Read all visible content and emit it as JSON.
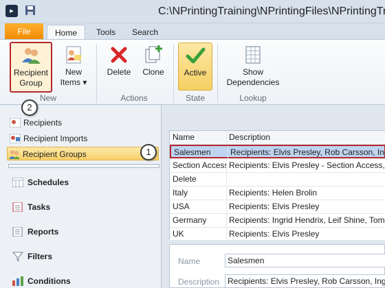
{
  "window": {
    "title": "C:\\NPrintingTraining\\NPrintingFiles\\NPrintingTrain"
  },
  "tabs": {
    "file": "File",
    "home": "Home",
    "tools": "Tools",
    "search": "Search"
  },
  "ribbon": {
    "recipient_group": [
      "Recipient",
      "Group"
    ],
    "new_items": [
      "New",
      "Items ▾"
    ],
    "delete": "Delete",
    "clone": "Clone",
    "active": "Active",
    "show_dependencies": [
      "Show",
      "Dependencies"
    ],
    "groups": {
      "new": "New",
      "actions": "Actions",
      "state": "State",
      "lookup": "Lookup"
    }
  },
  "nav": {
    "items": [
      "Recipients",
      "Recipient Imports",
      "Recipient Groups"
    ],
    "sections": [
      "Schedules",
      "Tasks",
      "Reports",
      "Filters",
      "Conditions"
    ]
  },
  "badges": {
    "one": "1",
    "two": "2"
  },
  "grid": {
    "headers": [
      "Name",
      "Description"
    ],
    "rows": [
      [
        "Salesmen",
        "Recipients: Elvis Presley, Rob Carsson, Ingrid"
      ],
      [
        "Section Access",
        "Recipients: Elvis Presley - Section Access, H"
      ],
      [
        "Delete",
        ""
      ],
      [
        "Italy",
        "Recipients: Helen Brolin"
      ],
      [
        "USA",
        "Recipients: Elvis Presley"
      ],
      [
        "Germany",
        "Recipients: Ingrid Hendrix, Leif Shine, Tom"
      ],
      [
        "UK",
        "Recipients: Elvis Presley"
      ]
    ]
  },
  "detail": {
    "name_label": "Name",
    "name_value": "Salesmen",
    "description_label": "Description",
    "description_value": "Recipients: Elvis Presley, Rob Carsson, Ingrid"
  },
  "colors": {
    "accent_red": "#b3262e",
    "file_tab": "#f08a00",
    "selection": "#bfd4f0",
    "active_yellow": "#f6cf62"
  }
}
